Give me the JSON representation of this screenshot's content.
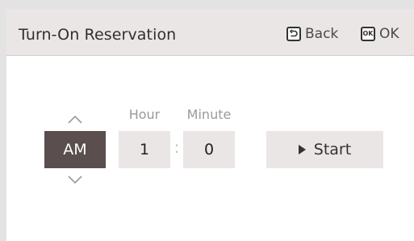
{
  "header": {
    "title": "Turn-On Reservation",
    "back_label": "Back",
    "ok_label": "OK",
    "ok_icon_text": "OK"
  },
  "picker": {
    "hour_label": "Hour",
    "minute_label": "Minute",
    "ampm_value": "AM",
    "hour_value": "1",
    "minute_value": "0",
    "separator": ":"
  },
  "actions": {
    "start_label": "Start"
  },
  "colors": {
    "header_bg": "#ebe6e6",
    "selected_bg": "#5a4e4e",
    "field_bg": "#ebe6e6"
  },
  "icons": {
    "back": "back-arrow-icon",
    "ok": "ok-key-icon",
    "up": "chevron-up-icon",
    "down": "chevron-down-icon",
    "start": "play-icon"
  }
}
